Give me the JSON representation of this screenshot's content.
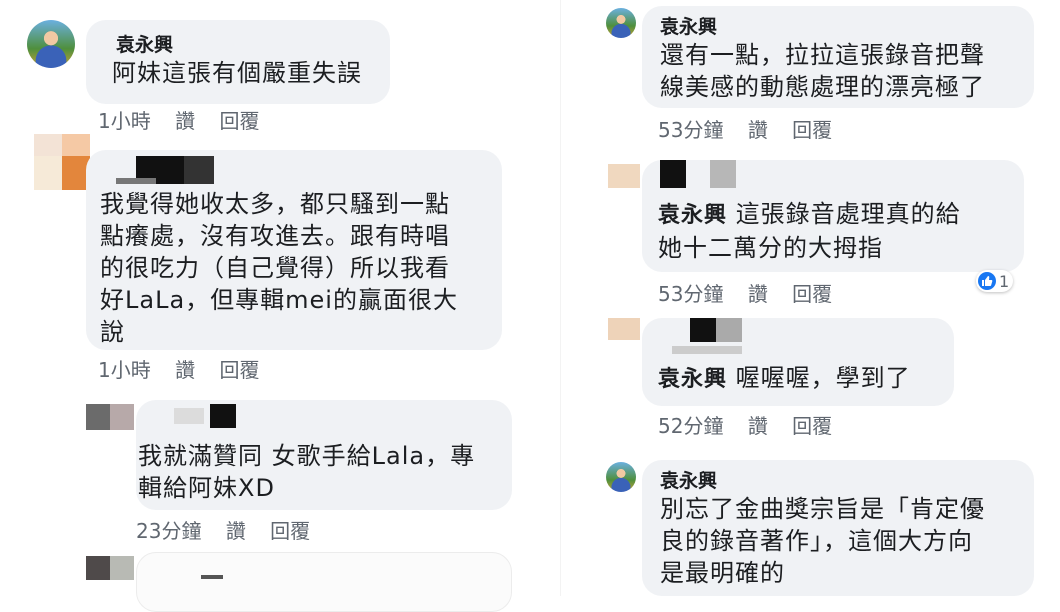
{
  "left": {
    "c1": {
      "author": "袁永興",
      "text": "阿妹這張有個嚴重失誤",
      "time": "1小時",
      "like": "讚",
      "reply": "回覆"
    },
    "c2": {
      "lines": [
        "我覺得她收太多，都只騷到一點",
        "點癢處，沒有攻進去。跟有時唱",
        "的很吃力（自己覺得）所以我看",
        "好LaLa，但專輯mei的贏面很大",
        "說"
      ],
      "time": "1小時",
      "like": "讚",
      "reply": "回覆"
    },
    "c3": {
      "lines": [
        "我就滿贊同 女歌手給Lala，專",
        "輯給阿妹XD"
      ],
      "time": "23分鐘",
      "like": "讚",
      "reply": "回覆"
    }
  },
  "right": {
    "r1": {
      "author": "袁永興",
      "lines": [
        "還有一點，拉拉這張錄音把聲",
        "線美感的動態處理的漂亮極了"
      ],
      "time": "53分鐘",
      "like": "讚",
      "reply": "回覆"
    },
    "r2": {
      "author": "袁永興",
      "line1_rest": " 這張錄音處理真的給",
      "line2": "她十二萬分的大拇指",
      "reaction_count": "1",
      "time": "53分鐘",
      "like": "讚",
      "reply": "回覆"
    },
    "r3": {
      "author": "袁永興",
      "text": " 喔喔喔，學到了",
      "time": "52分鐘",
      "like": "讚",
      "reply": "回覆"
    },
    "r4": {
      "author": "袁永興",
      "lines": [
        "別忘了金曲獎宗旨是「肯定優",
        "良的錄音著作」，這個大方向",
        "是最明確的"
      ]
    }
  },
  "colors": {
    "bubble": "#f0f2f5",
    "meta": "#606770",
    "like_blue": "#1877f2"
  }
}
